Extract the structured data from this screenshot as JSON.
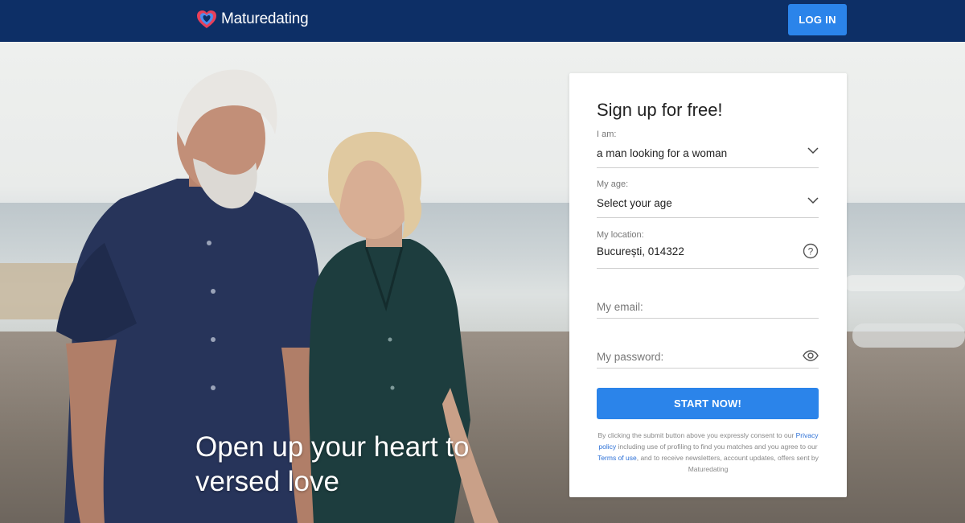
{
  "header": {
    "logo_text": "Maturedating",
    "login_label": "LOG IN",
    "background_color": "#0d2f66",
    "button_color": "#2b84ea"
  },
  "hero": {
    "headline": "Open up your heart to versed love"
  },
  "signup": {
    "title": "Sign up for free!",
    "i_am_label": "I am:",
    "i_am_value": "a man looking for a woman",
    "age_label": "My age:",
    "age_value": "Select your age",
    "location_label": "My location:",
    "location_value": "București, 014322",
    "email_placeholder": "My email:",
    "password_placeholder": "My password:",
    "submit_label": "START NOW!",
    "consent": {
      "part1": "By clicking the submit button above you expressly consent to our ",
      "privacy_link": "Privacy policy",
      "part2": " including use of profiling to find you matches and you agree to our ",
      "terms_link": "Terms of use",
      "part3": ", and to receive newsletters, account updates, offers sent by Maturedating"
    }
  }
}
